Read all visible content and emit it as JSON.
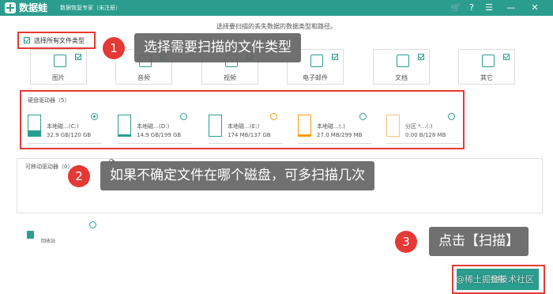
{
  "titlebar": {
    "app_name": "数据蛙",
    "app_subtitle": "数据恢复专家（未注册）",
    "icons": [
      "cart-icon",
      "help-icon",
      "menu-icon",
      "minimize-icon",
      "close-icon"
    ],
    "background_color": "#2a9d8f"
  },
  "subtitle": "选择要扫描的丢失数据的数据类型和路径。",
  "select_all": {
    "label": "选择所有文件类型",
    "checked": true
  },
  "file_types": [
    {
      "label": "图片",
      "checked": true,
      "icon": "image-icon"
    },
    {
      "label": "音频",
      "checked": true,
      "icon": "audio-icon"
    },
    {
      "label": "视频",
      "checked": true,
      "icon": "video-icon"
    },
    {
      "label": "电子邮件",
      "checked": true,
      "icon": "email-icon"
    },
    {
      "label": "文档",
      "checked": true,
      "icon": "document-icon"
    },
    {
      "label": "其它",
      "checked": true,
      "icon": "other-icon"
    }
  ],
  "disk_section": {
    "title": "硬盘驱动器（5）",
    "drives": [
      {
        "name": "本地磁…(C:)",
        "size": "32.9 GB/120 GB",
        "used_fraction": 0.27,
        "selected": true,
        "color": "#2a9d8f"
      },
      {
        "name": "本地磁…(D:)",
        "size": "14.9 GB/199 GB",
        "used_fraction": 0.07,
        "selected": false,
        "color": "#2a9d8f"
      },
      {
        "name": "本地磁…(E:)",
        "size": "174 MB/137 GB",
        "used_fraction": 0.01,
        "selected": false,
        "color": "#2a9d8f"
      },
      {
        "name": "本地磁…(:)",
        "size": "27.0 MB/299 MB",
        "used_fraction": 0.09,
        "selected": false,
        "color": "#f39c12"
      },
      {
        "name": "分区 *…(:)",
        "size": "0.00  B/128 MB",
        "used_fraction": 0.0,
        "selected": false,
        "color": "#f5c07a"
      }
    ]
  },
  "removable_section": {
    "title": "可移动驱动器（0）"
  },
  "recycle_bin": {
    "label": "回收站",
    "icon": "trash-icon"
  },
  "callouts": [
    {
      "number": "1",
      "text": "选择需要扫描的文件类型"
    },
    {
      "number": "2",
      "text": "如果不确定文件在哪个磁盘，可多扫描几次"
    },
    {
      "number": "3",
      "text": "点击【扫描】"
    }
  ],
  "scan_button": {
    "label": "扫描"
  },
  "watermark": "@稀土掘金技术社区",
  "colors": {
    "accent": "#2a9d8f",
    "highlight": "#e53935",
    "callout_bg": "#646464"
  }
}
